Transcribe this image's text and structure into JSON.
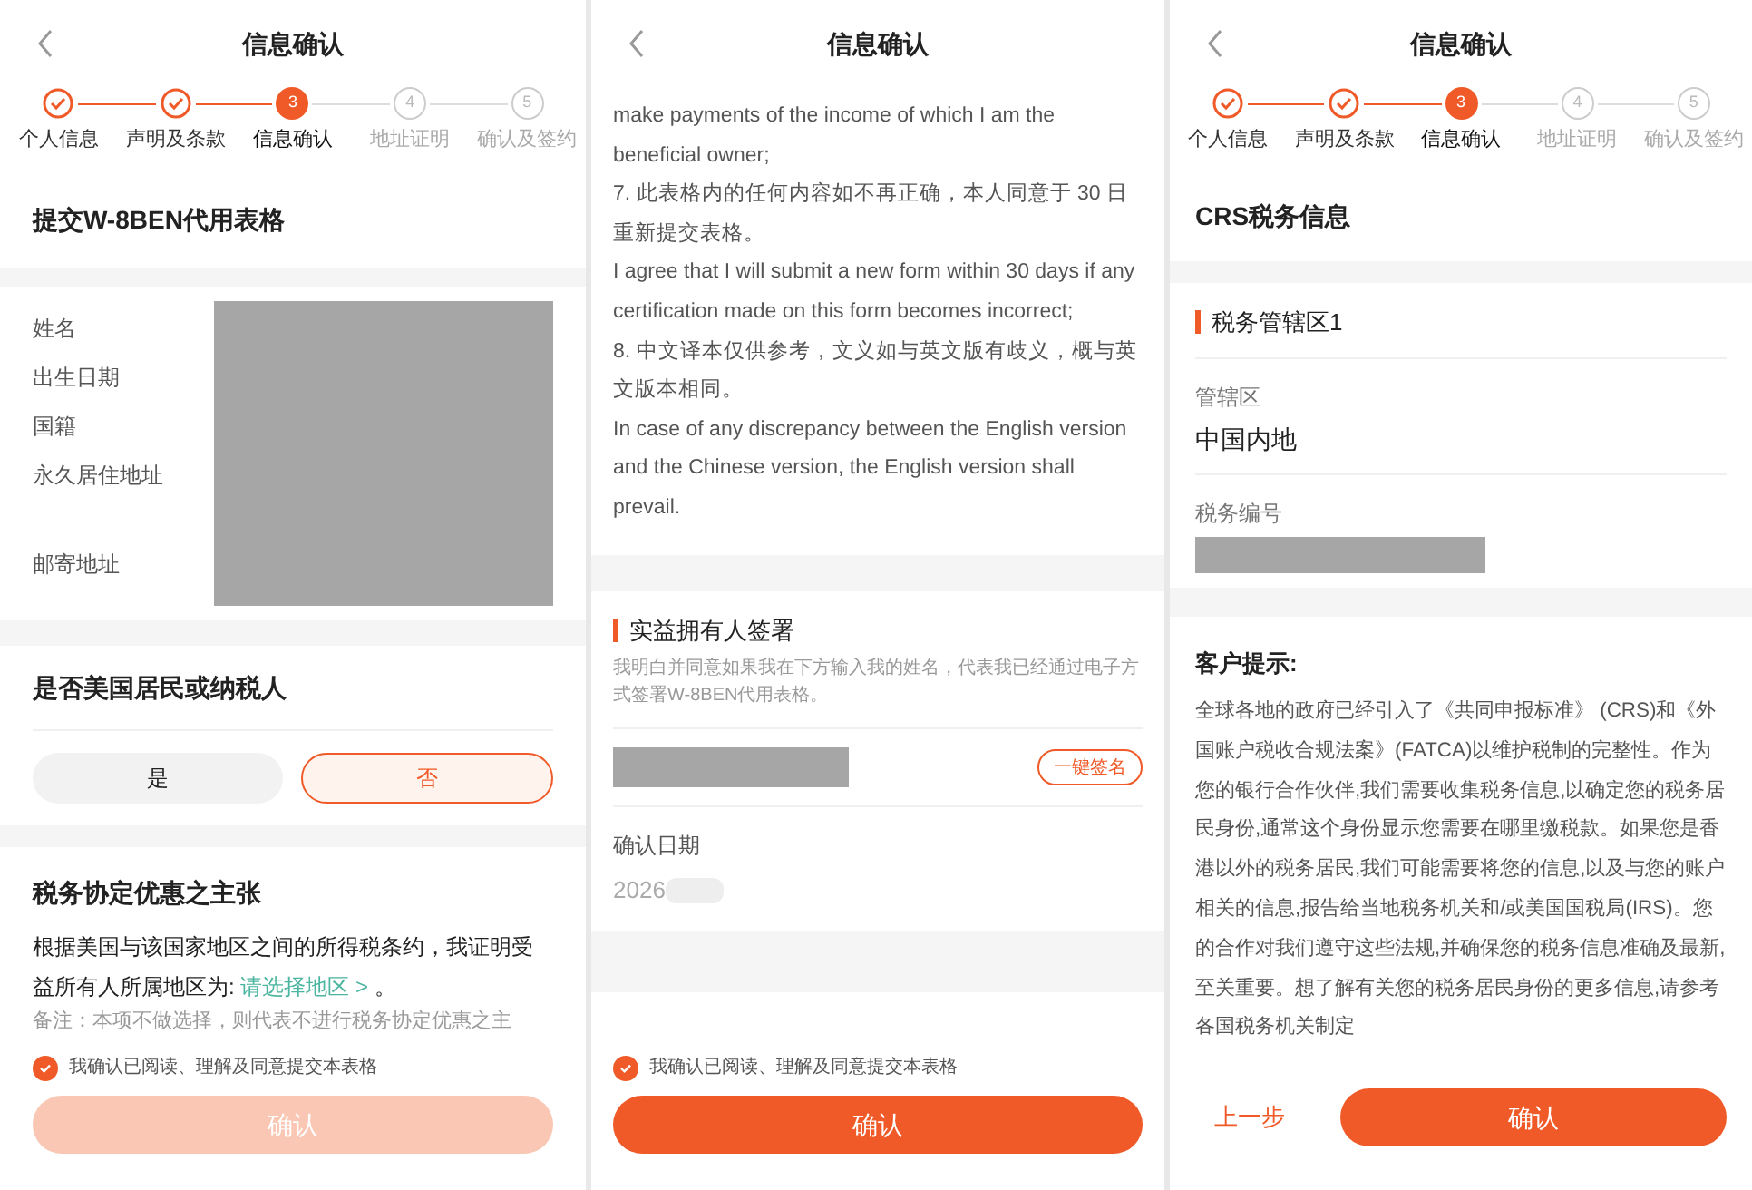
{
  "left_screen": {
    "title": "信息确认",
    "steps": [
      {
        "label": "个人信息",
        "completed": true,
        "selected": false
      },
      {
        "label": "声明及条款",
        "completed": true,
        "selected": false
      },
      {
        "number": "3",
        "label": "信息确认",
        "completed": false,
        "selected": true
      },
      {
        "number": "4",
        "label": "地址证明",
        "completed": false,
        "selected": false
      },
      {
        "number": "5",
        "label": "确认及签约",
        "completed": false,
        "selected": false
      }
    ],
    "form_title": "提交W-8BEN代用表格",
    "info_labels": [
      "姓名",
      "出生日期",
      "国籍",
      "永久居住地址",
      "邮寄地址"
    ],
    "us_question": "是否美国居民或纳税人",
    "options": [
      {
        "label": "是",
        "selected": false
      },
      {
        "label": "否",
        "selected": true
      }
    ],
    "treaty_title": "税务协定优惠之主张",
    "treaty_text": "根据美国与该国家地区之间的所得税条约，我证明受益所有人所属地区为:",
    "region_link": "请选择地区 >",
    "treaty_end": "。",
    "note": "备注：本项不做选择，则代表不进行税务协定优惠之主",
    "agreement": {
      "label": "我确认已阅读、理解及同意提交本表格",
      "checked": true
    },
    "confirm_button": {
      "label": "确认",
      "disabled": true
    }
  },
  "middle_screen": {
    "title": "信息确认",
    "terms": [
      "make payments of the income of which I am the beneficial owner;",
      "7. 此表格内的任何内容如不再正确，本人同意于 30 日重新提交表格。",
      "I agree that I will submit a new form within 30 days if any certification made on this form becomes incorrect;",
      "8. 中文译本仅供参考，文义如与英文版有歧义，概与英文版本相同。",
      "In case of any discrepancy between the English version and the Chinese version, the English version shall prevail."
    ],
    "signature_title": "实益拥有人签署",
    "signature_text": "我明白并同意如果我在下方输入我的姓名，代表我已经通过电子方式签署W-8BEN代用表格。",
    "sign_button": "一键签名",
    "date_label": "确认日期",
    "date_value": "2026",
    "agreement": {
      "label": "我确认已阅读、理解及同意提交本表格",
      "checked": true
    },
    "confirm_button": {
      "label": "确认",
      "disabled": false
    }
  },
  "right_screen": {
    "title": "信息确认",
    "steps": [
      {
        "label": "个人信息",
        "completed": true,
        "selected": false
      },
      {
        "label": "声明及条款",
        "completed": true,
        "selected": false
      },
      {
        "number": "3",
        "label": "信息确认",
        "completed": false,
        "selected": true
      },
      {
        "number": "4",
        "label": "地址证明",
        "completed": false,
        "selected": false
      },
      {
        "number": "5",
        "label": "确认及签约",
        "completed": false,
        "selected": false
      }
    ],
    "section_title": "CRS税务信息",
    "jurisdiction_title": "税务管辖区1",
    "fields": [
      {
        "label": "管辖区",
        "value": "中国内地"
      },
      {
        "label": "税务编号"
      }
    ],
    "notice_title": "客户提示:",
    "notice_text": "全球各地的政府已经引入了《共同申报标准》 (CRS)和《外国账户税收合规法案》(FATCA)以维护税制的完整性。作为您的银行合作伙伴,我们需要收集税务信息,以确定您的税务居民身份,通常这个身份显示您需要在哪里缴税款。如果您是香港以外的税务居民,我们可能需要将您的信息,以及与您的账户相关的信息,报告给当地税务机关和/或美国国税局(IRS)。您的合作对我们遵守这些法规,并确保您的税务信息准确及最新,至关重要。想了解有关您的税务居民身份的更多信息,请参考各国税务机关制定",
    "back_button": "上一步",
    "confirm_button": {
      "label": "确认",
      "disabled": false
    }
  }
}
